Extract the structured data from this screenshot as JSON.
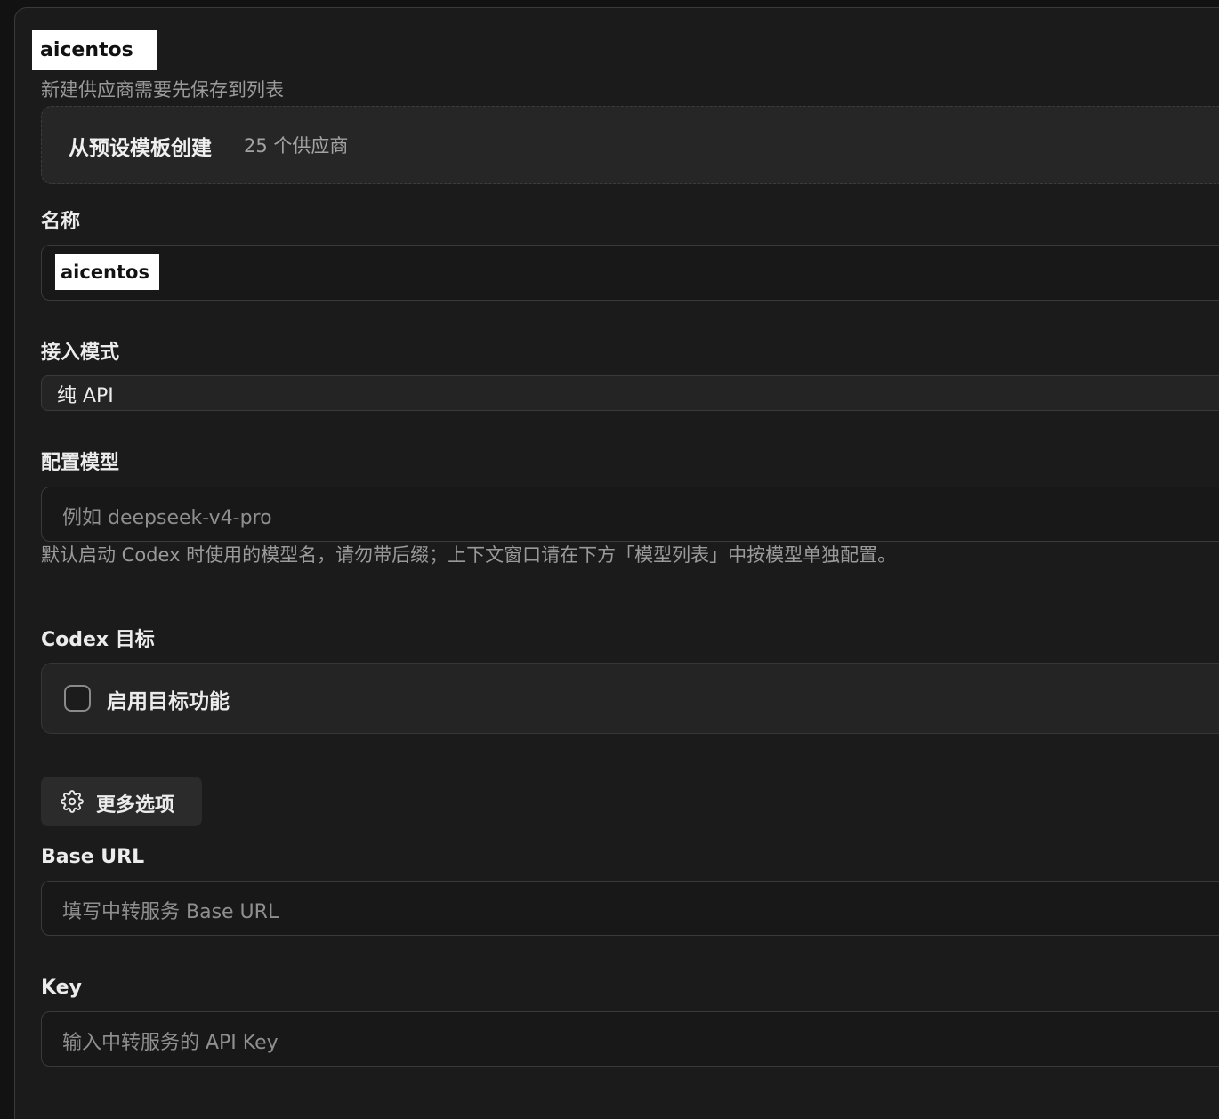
{
  "header": {
    "provider_name_chip": "aicentos",
    "save_hint": "新建供应商需要先保存到列表"
  },
  "template": {
    "title": "从预设模板创建",
    "count": "25 个供应商"
  },
  "name_field": {
    "label": "名称",
    "value": "aicentos"
  },
  "access_mode": {
    "label": "接入模式",
    "selected": "纯 API"
  },
  "model_field": {
    "label": "配置模型",
    "placeholder": "例如 deepseek-v4-pro",
    "hint": "默认启动 Codex 时使用的模型名，请勿带后缀；上下文窗口请在下方「模型列表」中按模型单独配置。"
  },
  "codex_target": {
    "label": "Codex 目标",
    "toggle_label": "启用目标功能",
    "enabled": false
  },
  "more_options": {
    "label": "更多选项",
    "icon": "gear-icon"
  },
  "base_url_field": {
    "label": "Base URL",
    "placeholder": "填写中转服务 Base URL"
  },
  "key_field": {
    "label": "Key",
    "placeholder": "输入中转服务的 API Key"
  }
}
